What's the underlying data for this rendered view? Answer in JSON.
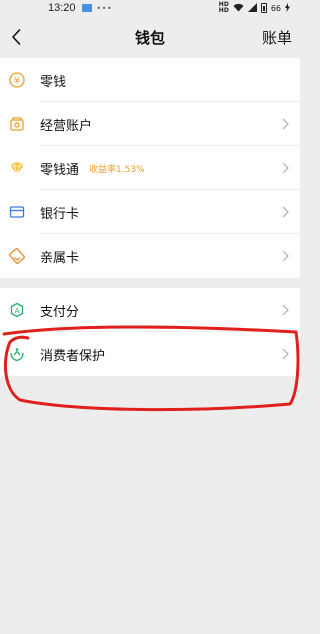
{
  "status": {
    "time": "13:20",
    "battery": "66"
  },
  "nav": {
    "title": "钱包",
    "right": "账单"
  },
  "items_group1": [
    {
      "label": "零钱",
      "icon": "coin-icon"
    },
    {
      "label": "经营账户",
      "icon": "store-account-icon"
    },
    {
      "label": "零钱通",
      "icon": "diamond-icon",
      "badge": "收益率1.53%"
    },
    {
      "label": "银行卡",
      "icon": "bank-card-icon"
    },
    {
      "label": "亲属卡",
      "icon": "family-card-icon"
    }
  ],
  "items_group2": [
    {
      "label": "支付分",
      "icon": "pay-score-icon"
    },
    {
      "label": "消费者保护",
      "icon": "consumer-protection-icon"
    }
  ],
  "colors": {
    "gold": "#e9a12a",
    "green": "#2aae67",
    "blue": "#3a7bd5",
    "annotation_red": "#e0201c"
  }
}
